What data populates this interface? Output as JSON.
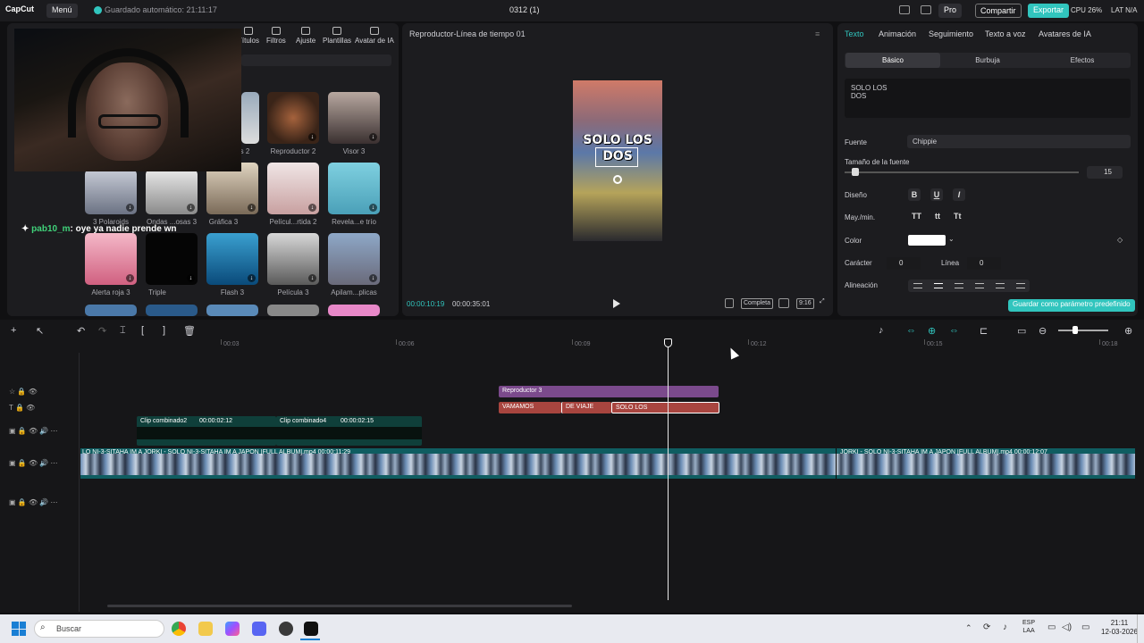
{
  "titlebar": {
    "logo": "CapCut",
    "menu": "Menú",
    "autosave": "Guardado automático: 21:11:17",
    "project": "0312 (1)",
    "pro": "Pro",
    "share": "Compartir",
    "export": "Exportar",
    "cpu": "CPU 26%",
    "lat": "LAT N/A"
  },
  "left_tabs": [
    "Títulos",
    "Filtros",
    "Ajuste",
    "Plantillas",
    "Avatar de IA"
  ],
  "chat": {
    "name": "pab10_m",
    "message": ": oye ya nadie prende wn"
  },
  "templates": [
    {
      "label": "…s 2"
    },
    {
      "label": "Reproductor 2"
    },
    {
      "label": "Visor 3"
    },
    {
      "label": "3 Polaroids"
    },
    {
      "label": "Ondas ...osas 3"
    },
    {
      "label": "Gráfica 3"
    },
    {
      "label": "Películ...rtida 2"
    },
    {
      "label": "Revela...e trío"
    },
    {
      "label": "Alerta roja 3"
    },
    {
      "label": "Triple"
    },
    {
      "label": "Flash 3"
    },
    {
      "label": "Película 3"
    },
    {
      "label": "Apilam...plicas"
    }
  ],
  "viewer": {
    "title": "Reproductor-Línea de tiempo 01",
    "overlay_text": "SOLO LOS\nDOS",
    "current_time": "00:00:10:19",
    "total_time": "00:00:35:01",
    "full_label": "Completa",
    "ratio_label": "9:16"
  },
  "props": {
    "tabs": [
      "Texto",
      "Animación",
      "Seguimiento",
      "Texto a voz",
      "Avatares de IA"
    ],
    "subtabs": [
      "Básico",
      "Burbuja",
      "Efectos"
    ],
    "text_value": "SOLO LOS\nDOS",
    "font_label": "Fuente",
    "font_value": "Chippie",
    "size_label": "Tamaño de la fuente",
    "size_value": "15",
    "design_label": "Diseño",
    "bold": "B",
    "underline": "U",
    "italic": "I",
    "case_label": "May./min.",
    "case_opts": [
      "TT",
      "tt",
      "Tt"
    ],
    "color_label": "Color",
    "color_value": "#ffffff",
    "char_label": "Carácter",
    "char_value": "0",
    "line_label": "Línea",
    "line_value": "0",
    "align_label": "Alineación",
    "save_default": "Guardar como parámetro predefinido"
  },
  "timeline": {
    "ruler": [
      "00:03",
      "00:06",
      "00:09",
      "00:12",
      "00:15",
      "00:18"
    ],
    "effect_clip": "Reproductor 3",
    "text_clips": [
      "VAMAMOS",
      "DE VIAJE",
      "SOLO LOS"
    ],
    "comp_clips": [
      {
        "name": "Clip combinado2",
        "duration": "00:00:02:12"
      },
      {
        "name": "Clip combinado4",
        "duration": "00:00:02:15"
      }
    ],
    "video_clip_label": "LO NI-3-SITAHA IM A JORKI - SOLO NI-3-SITAHA IM A JAPÓN [FULL ALBUM].mp4   00:00:11:29",
    "video_clip_label2": "JORKI - SOLO NI-3-SITAHA IM A JAPÓN [FULL ALBUM].mp4   00:00:12:07"
  },
  "taskbar": {
    "search": "Buscar",
    "lang": "ESP\nLAA",
    "time": "21:11",
    "date": "12-03-2026"
  }
}
